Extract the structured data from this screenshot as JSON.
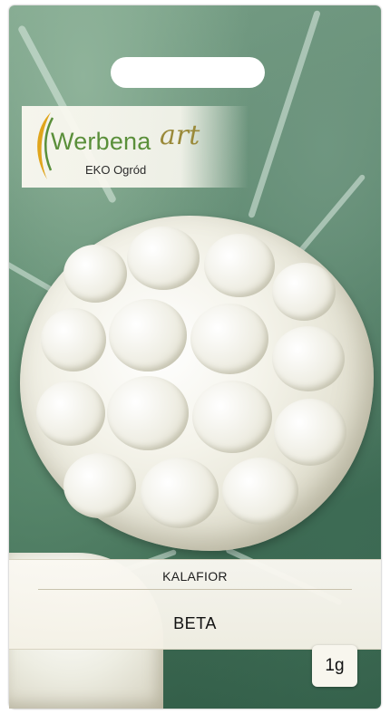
{
  "packet": {
    "brand_main": "Werbena",
    "brand_script": "art",
    "brand_sub": "EKO Ogród",
    "species": "KALAFIOR",
    "variety": "BETA",
    "weight": "1g"
  },
  "colors": {
    "brand_green": "#5a8f3a",
    "brand_gold": "#9a8a3a",
    "leaf_green": "#4f7d63",
    "cauliflower": "#f4f3ea"
  },
  "icons": {
    "logo_mark": "leaf-swoosh-icon"
  }
}
